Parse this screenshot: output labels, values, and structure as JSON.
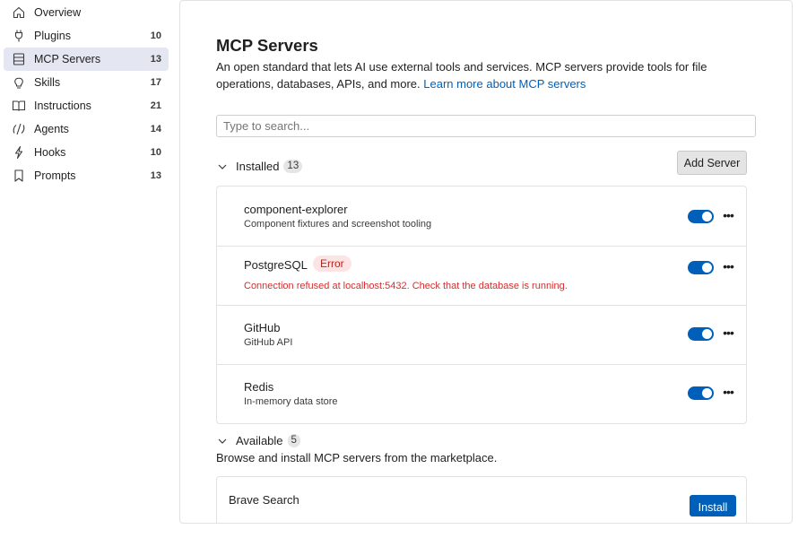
{
  "sidebar": {
    "items": [
      {
        "label": "Overview",
        "count": "",
        "icon": "home-icon"
      },
      {
        "label": "Plugins",
        "count": "10",
        "icon": "plug-icon"
      },
      {
        "label": "MCP Servers",
        "count": "13",
        "icon": "server-icon",
        "active": true
      },
      {
        "label": "Skills",
        "count": "17",
        "icon": "lightbulb-icon"
      },
      {
        "label": "Instructions",
        "count": "21",
        "icon": "book-icon"
      },
      {
        "label": "Agents",
        "count": "14",
        "icon": "agent-icon"
      },
      {
        "label": "Hooks",
        "count": "10",
        "icon": "lightning-icon"
      },
      {
        "label": "Prompts",
        "count": "13",
        "icon": "bookmark-icon"
      }
    ]
  },
  "main": {
    "title": "MCP Servers",
    "description": "An open standard that lets AI use external tools and services. MCP servers provide tools for file operations, databases, APIs, and more.",
    "learn_more": "Learn more about MCP servers",
    "search_placeholder": "Type to search...",
    "add_server_label": "Add Server",
    "installed": {
      "label": "Installed",
      "count": "13",
      "servers": [
        {
          "name": "component-explorer",
          "description": "Component fixtures and screenshot tooling",
          "enabled": true
        },
        {
          "name": "PostgreSQL",
          "badge": "Error",
          "error": "Connection refused at localhost:5432. Check that the database is running.",
          "enabled": true
        },
        {
          "name": "GitHub",
          "description": "GitHub API",
          "enabled": true
        },
        {
          "name": "Redis",
          "description": "In-memory data store",
          "enabled": true
        }
      ]
    },
    "available": {
      "label": "Available",
      "count": "5",
      "description": "Browse and install MCP servers from the marketplace.",
      "servers": [
        {
          "name": "Brave Search",
          "button": "Install"
        }
      ]
    }
  },
  "colors": {
    "accent": "#005fb8",
    "active_nav": "#e4e6f1",
    "error_text": "#d32f2f",
    "error_badge_bg": "#fde4e4"
  }
}
